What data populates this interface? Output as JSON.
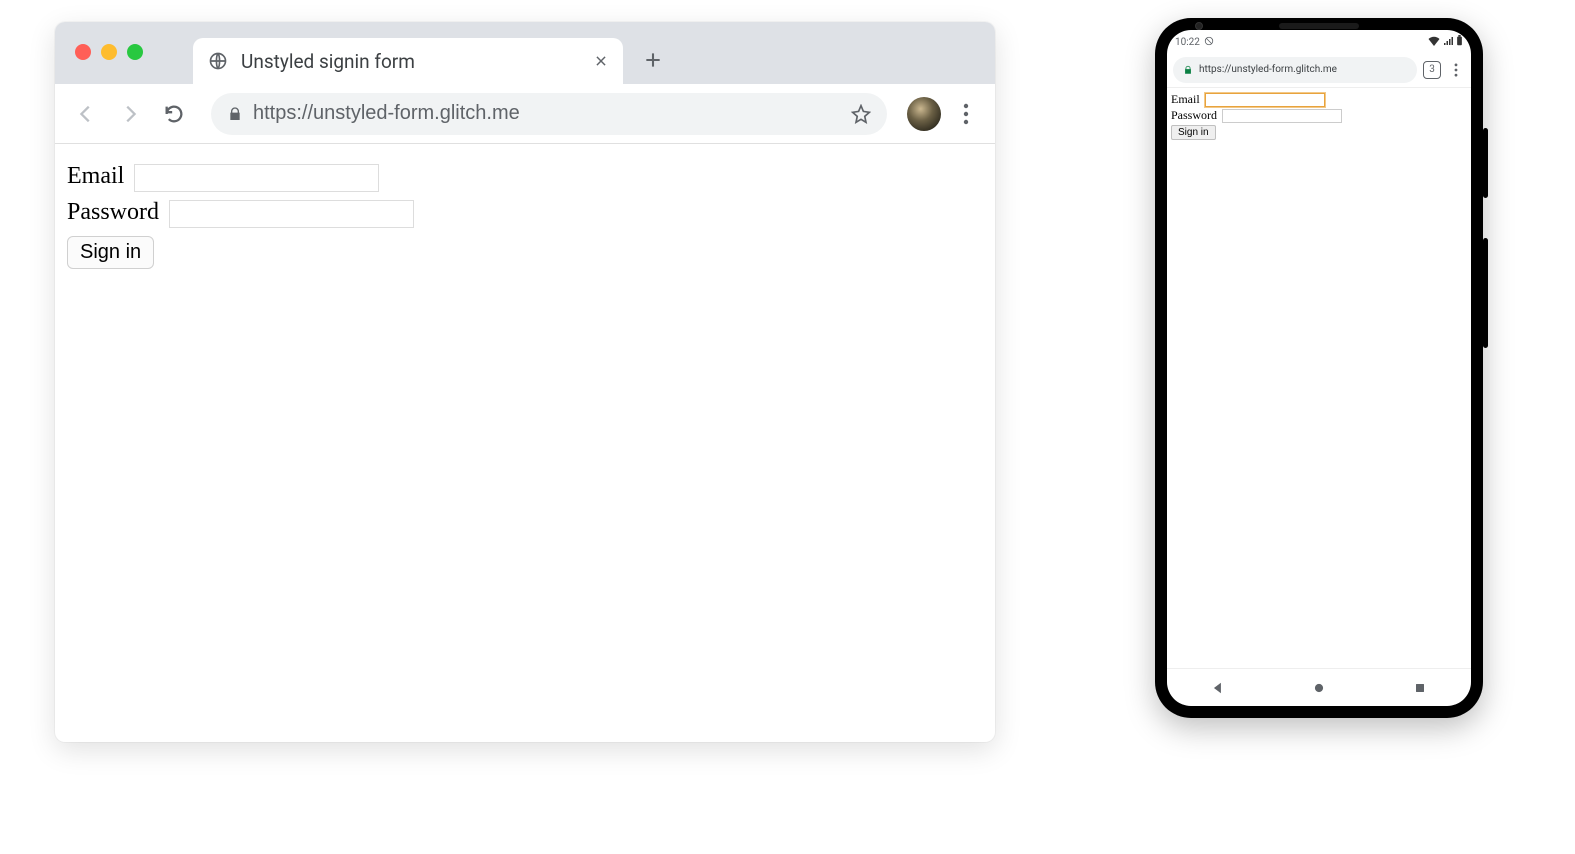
{
  "desktop": {
    "tab": {
      "title": "Unstyled signin form"
    },
    "url": "https://unstyled-form.glitch.me",
    "form": {
      "email_label": "Email",
      "password_label": "Password",
      "signin_label": "Sign in"
    }
  },
  "phone": {
    "status": {
      "time": "10:22"
    },
    "url": "https://unstyled-form.glitch.me",
    "tab_count": "3",
    "form": {
      "email_label": "Email",
      "password_label": "Password",
      "signin_label": "Sign in"
    }
  }
}
